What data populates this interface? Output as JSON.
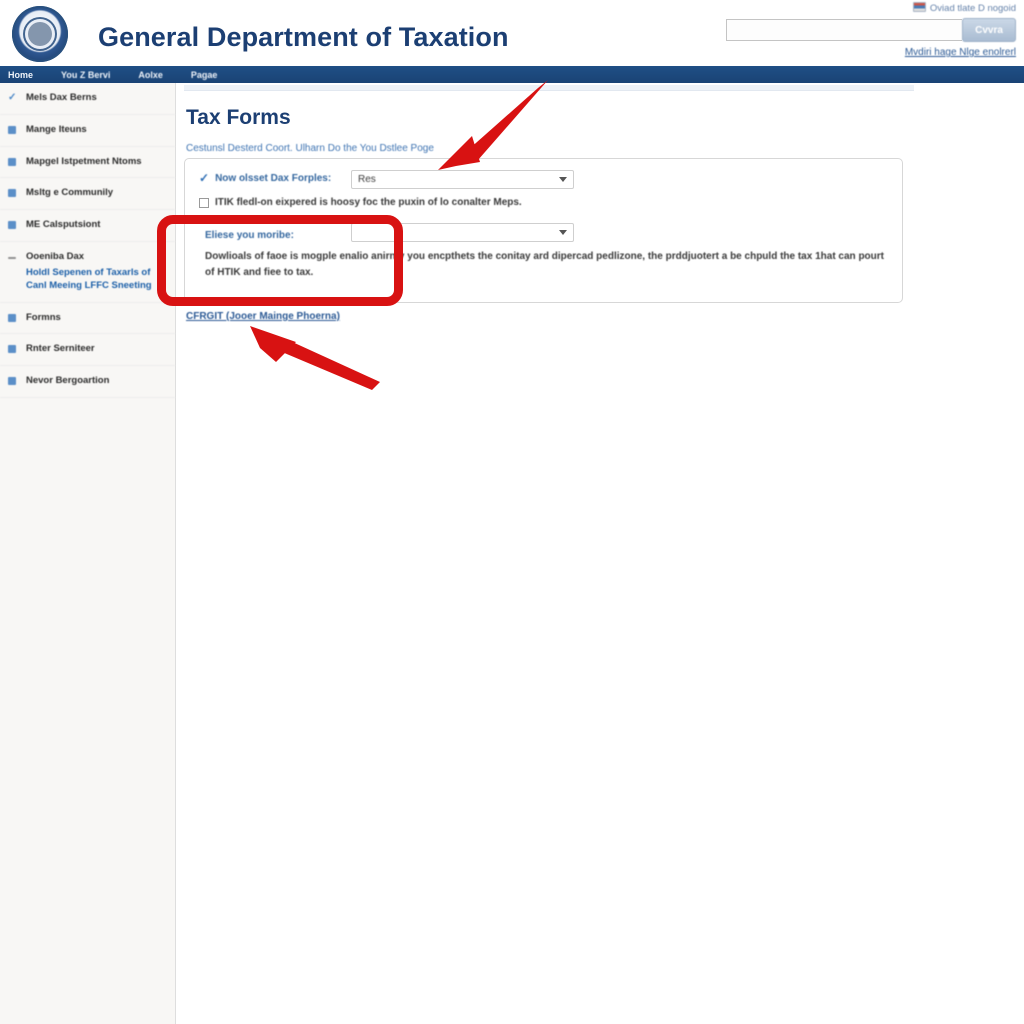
{
  "header": {
    "site_title": "General Department of Taxation",
    "logo_icon": "government-seal-icon",
    "top_link": "Oviad tlate D nogoid",
    "flag_icon": "flag-icon",
    "search": {
      "value": "",
      "placeholder": "",
      "button_label": "Cvvra"
    },
    "bottom_link": "Mvdiri hage Nlge enolrerl"
  },
  "nav": {
    "items": [
      {
        "label": "Home"
      },
      {
        "label": "You Z Bervi"
      },
      {
        "label": "Aolxe"
      },
      {
        "label": "Pagae"
      }
    ]
  },
  "sidebar": {
    "items": [
      {
        "label": "Mels Dax Berns",
        "icon": "check-icon"
      },
      {
        "label": "Mange Iteuns",
        "icon": "square-icon"
      },
      {
        "label": "Mapgel Istpetment Ntoms",
        "icon": "square-icon"
      },
      {
        "label": "Msltg e Communily",
        "icon": "square-icon"
      },
      {
        "label": "ME Calsputsiont",
        "icon": "square-icon"
      },
      {
        "label": "Ooeniba Dax",
        "icon": "minus-icon",
        "sub": "Holdl Sepenen of Taxarls of Canl Meeing LFFC Sneeting"
      },
      {
        "label": "Formns",
        "icon": "square-icon"
      },
      {
        "label": "Rnter Serniteer",
        "icon": "square-icon"
      },
      {
        "label": "Nevor Bergoartion",
        "icon": "square-icon"
      }
    ]
  },
  "main": {
    "page_title": "Tax Forms",
    "breadcrumb": "Cestunsl Desterd Coort. Ulharn Do the You Dstlee Poge",
    "form": {
      "row1_icon": "blue-check-icon",
      "row1_label": "Now olsset Dax Forples:",
      "row1_select_value": "Res",
      "row1_select_caret": "chevron-down-icon",
      "row2_checkbox_label": "ITIK fledl-on eixpered is hoosy foc the puxin of lo conalter Meps.",
      "row3_label": "Eliese you moribe:",
      "row3_select_value": "",
      "row3_select_caret": "chevron-down-icon",
      "paragraph": "Dowlioals of faoe is mogple enalio anirnty you encpthets the conitay ard dipercad pedlizone, the prddjuotert a be chpuld the tax 1hat can pourt of HTIK and fiee to tax."
    },
    "footer_link": "CFRGIT (Jooer Mainge Phoerna)"
  },
  "annotations": {
    "color": "#d81212",
    "highlight_box": "red-highlight-box",
    "arrow_top": "red-arrow-down-left",
    "arrow_bottom": "red-arrow-up-left"
  }
}
